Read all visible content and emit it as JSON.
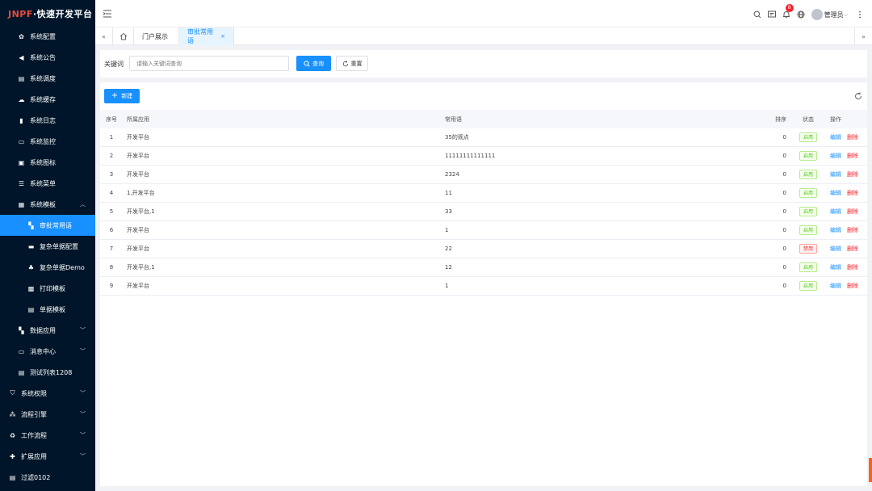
{
  "app": {
    "logo_prefix": "JNPF",
    "logo_suffix": "·快速开发平台"
  },
  "sidebar": {
    "items": [
      {
        "label": "系统配置",
        "icon": "gear-icon",
        "level": "child"
      },
      {
        "label": "系统公告",
        "icon": "megaphone-icon",
        "level": "child"
      },
      {
        "label": "系统调度",
        "icon": "schedule-icon",
        "level": "child"
      },
      {
        "label": "系统缓存",
        "icon": "cloud-icon",
        "level": "child"
      },
      {
        "label": "系统日志",
        "icon": "log-icon",
        "level": "child"
      },
      {
        "label": "系统监控",
        "icon": "monitor-icon",
        "level": "child"
      },
      {
        "label": "系统图标",
        "icon": "icon-library-icon",
        "level": "child"
      },
      {
        "label": "系统菜单",
        "icon": "menu-icon",
        "level": "child"
      },
      {
        "label": "系统模板",
        "icon": "template-icon",
        "level": "child",
        "expanded": true
      },
      {
        "label": "审批常用语",
        "icon": "grid-icon",
        "level": "sub",
        "active": true
      },
      {
        "label": "复杂单据配置",
        "icon": "box-icon",
        "level": "sub"
      },
      {
        "label": "复杂单据Demo",
        "icon": "org-icon",
        "level": "sub"
      },
      {
        "label": "打印模板",
        "icon": "printer-icon",
        "level": "sub"
      },
      {
        "label": "单据模板",
        "icon": "document-icon",
        "level": "sub"
      },
      {
        "label": "数据应用",
        "icon": "grid-icon",
        "level": "child",
        "collapsible": true
      },
      {
        "label": "消息中心",
        "icon": "message-icon",
        "level": "child",
        "collapsible": true
      },
      {
        "label": "测试列表1208",
        "icon": "document-icon",
        "level": "child"
      },
      {
        "label": "系统权限",
        "icon": "shield-icon",
        "level": "top",
        "collapsible": true
      },
      {
        "label": "流程引擎",
        "icon": "flow-icon",
        "level": "top",
        "collapsible": true
      },
      {
        "label": "工作流程",
        "icon": "workflow-icon",
        "level": "top",
        "collapsible": true
      },
      {
        "label": "扩展应用",
        "icon": "puzzle-icon",
        "level": "top",
        "collapsible": true
      },
      {
        "label": "过滤0102",
        "icon": "document-icon",
        "level": "top"
      }
    ]
  },
  "header": {
    "notification_count": "8",
    "user_name": "管理员"
  },
  "tabs": [
    {
      "label": "门户展示",
      "active": false
    },
    {
      "label": "审批常用语",
      "active": true,
      "close": "×"
    }
  ],
  "search": {
    "label": "关键词",
    "placeholder": "请输入关键词查询",
    "query_label": "查询",
    "reset_label": "重置"
  },
  "toolbar": {
    "new_label": "新建"
  },
  "table": {
    "headers": {
      "index": "序号",
      "app": "所属应用",
      "phrase": "常用语",
      "sort": "排序",
      "status": "状态",
      "actions": "操作"
    },
    "edit_label": "编辑",
    "delete_label": "删除",
    "rows": [
      {
        "index": "1",
        "app": "开发平台",
        "phrase": "35的观点",
        "sort": "0",
        "status": "启用",
        "enabled": true
      },
      {
        "index": "2",
        "app": "开发平台",
        "phrase": "11111111111111",
        "sort": "0",
        "status": "启用",
        "enabled": true
      },
      {
        "index": "3",
        "app": "开发平台",
        "phrase": "2324",
        "sort": "0",
        "status": "启用",
        "enabled": true
      },
      {
        "index": "4",
        "app": "1,开发平台",
        "phrase": "11",
        "sort": "0",
        "status": "启用",
        "enabled": true
      },
      {
        "index": "5",
        "app": "开发平台,1",
        "phrase": "33",
        "sort": "0",
        "status": "启用",
        "enabled": true
      },
      {
        "index": "6",
        "app": "开发平台",
        "phrase": "1",
        "sort": "0",
        "status": "启用",
        "enabled": true
      },
      {
        "index": "7",
        "app": "开发平台",
        "phrase": "22",
        "sort": "0",
        "status": "禁用",
        "enabled": false
      },
      {
        "index": "8",
        "app": "开发平台,1",
        "phrase": "12",
        "sort": "0",
        "status": "启用",
        "enabled": true
      },
      {
        "index": "9",
        "app": "开发平台",
        "phrase": "1",
        "sort": "0",
        "status": "启用",
        "enabled": true
      }
    ]
  },
  "colors": {
    "primary": "#1890ff",
    "sidebar_bg": "#001529",
    "danger": "#f5222d",
    "success": "#52c41a"
  }
}
